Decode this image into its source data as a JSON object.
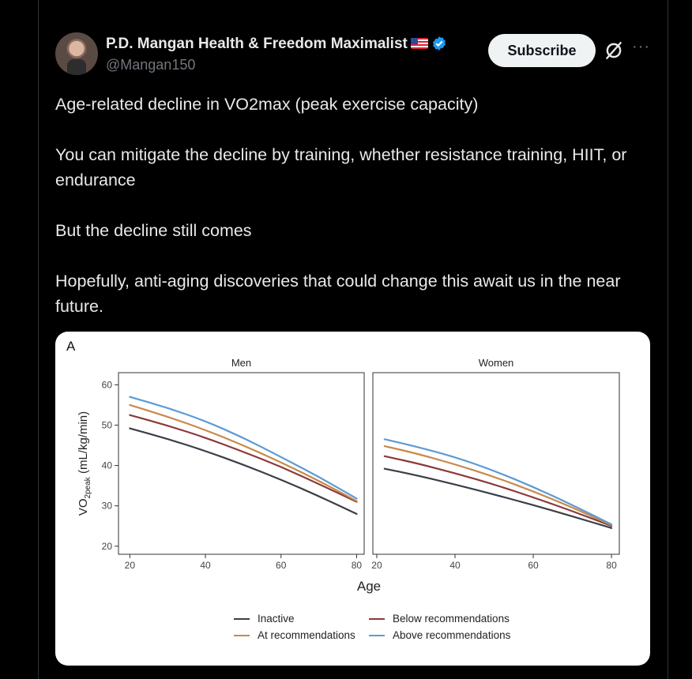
{
  "post": {
    "author_name": "P.D. Mangan Health & Freedom Maximalist",
    "handle": "@Mangan150",
    "subscribe_label": "Subscribe",
    "more_label": "···",
    "paragraphs": [
      "Age-related decline in VO2max (peak exercise capacity)",
      "You can mitigate the decline by training, whether resistance training, HIIT, or endurance",
      "But the decline still comes",
      "Hopefully, anti-aging discoveries that could change this await us in the near future."
    ]
  },
  "icons": {
    "verified": "verified-badge-icon",
    "flag": "us-flag-icon",
    "grok": "grok-icon",
    "more": "more-icon"
  },
  "colors": {
    "verified_blue": "#1d9bf0",
    "Inactive": "#3a3f47",
    "Below recommendations": "#8b3a3a",
    "At recommendations": "#c8894a",
    "Above recommendations": "#5b9bd5"
  },
  "chart_data": {
    "type": "line",
    "panel_label": "A",
    "ylabel": "VO2peak (mL/kg/min)",
    "ylabel_main": "VO",
    "ylabel_sub": "2peak",
    "ylabel_rest": " (mL/kg/min)",
    "xlabel": "Age",
    "ylim": [
      18,
      63
    ],
    "yticks": [
      20,
      30,
      40,
      50,
      60
    ],
    "panels": [
      {
        "title": "Men",
        "xlim": [
          17,
          82
        ],
        "xticks": [
          20,
          40,
          60,
          80
        ],
        "series": [
          {
            "name": "Inactive",
            "x": [
              20,
              30,
              40,
              50,
              60,
              70,
              80
            ],
            "y": [
              49.2,
              46.6,
              43.6,
              40.2,
              36.5,
              32.4,
              28.0
            ]
          },
          {
            "name": "Below recommendations",
            "x": [
              20,
              30,
              40,
              50,
              60,
              70,
              80
            ],
            "y": [
              52.5,
              49.9,
              46.9,
              43.4,
              39.7,
              35.4,
              31.0
            ]
          },
          {
            "name": "At recommendations",
            "x": [
              20,
              30,
              40,
              50,
              60,
              70,
              80
            ],
            "y": [
              55.0,
              52.1,
              48.8,
              45.0,
              40.8,
              36.2,
              31.2
            ]
          },
          {
            "name": "Above recommendations",
            "x": [
              20,
              30,
              40,
              50,
              60,
              70,
              80
            ],
            "y": [
              57.0,
              54.3,
              51.0,
              46.9,
              42.1,
              37.2,
              31.8
            ]
          }
        ]
      },
      {
        "title": "Women",
        "xlim": [
          19,
          82
        ],
        "xticks": [
          20,
          40,
          60,
          80
        ],
        "series": [
          {
            "name": "Inactive",
            "x": [
              22,
              30,
              40,
              50,
              60,
              70,
              80
            ],
            "y": [
              39.2,
              37.6,
              35.3,
              32.8,
              30.2,
              27.4,
              24.5
            ]
          },
          {
            "name": "Below recommendations",
            "x": [
              22,
              30,
              40,
              50,
              60,
              70,
              80
            ],
            "y": [
              42.3,
              40.6,
              38.1,
              35.3,
              32.1,
              28.7,
              25.0
            ]
          },
          {
            "name": "At recommendations",
            "x": [
              22,
              30,
              40,
              50,
              60,
              70,
              80
            ],
            "y": [
              44.8,
              43.0,
              40.3,
              37.2,
              33.6,
              29.6,
              25.2
            ]
          },
          {
            "name": "Above recommendations",
            "x": [
              22,
              30,
              40,
              50,
              60,
              70,
              80
            ],
            "y": [
              46.5,
              44.7,
              42.1,
              38.7,
              34.7,
              30.2,
              25.4
            ]
          }
        ]
      }
    ],
    "legend": [
      "Inactive",
      "Below recommendations",
      "At recommendations",
      "Above recommendations"
    ]
  }
}
